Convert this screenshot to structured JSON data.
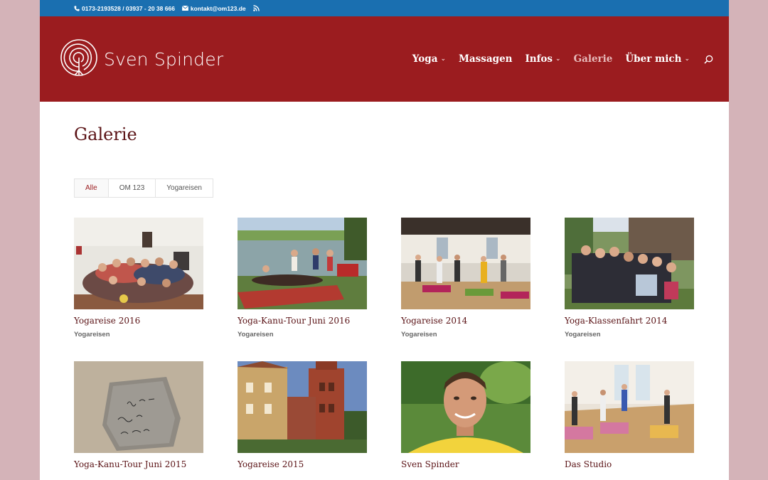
{
  "topbar": {
    "phone": "0173-2193528 / 03937 - 20 38 666",
    "email": "kontakt@om123.de"
  },
  "brand": {
    "name": "Sven Spinder"
  },
  "nav": [
    {
      "label": "Yoga",
      "dropdown": true,
      "active": false
    },
    {
      "label": "Massagen",
      "dropdown": false,
      "active": false
    },
    {
      "label": "Infos",
      "dropdown": true,
      "active": false
    },
    {
      "label": "Galerie",
      "dropdown": false,
      "active": true
    },
    {
      "label": "Über mich",
      "dropdown": true,
      "active": false
    }
  ],
  "page": {
    "title": "Galerie"
  },
  "filters": [
    "Alle",
    "OM 123",
    "Yogareisen"
  ],
  "gallery": [
    {
      "title": "Yogareise 2016",
      "category": "Yogareisen"
    },
    {
      "title": "Yoga-Kanu-Tour Juni 2016",
      "category": "Yogareisen"
    },
    {
      "title": "Yogareise 2014",
      "category": "Yogareisen"
    },
    {
      "title": "Yoga-Klassenfahrt 2014",
      "category": "Yogareisen"
    },
    {
      "title": "Yoga-Kanu-Tour Juni 2015",
      "category": ""
    },
    {
      "title": "Yogareise 2015",
      "category": ""
    },
    {
      "title": "Sven Spinder",
      "category": ""
    },
    {
      "title": "Das Studio",
      "category": ""
    }
  ],
  "colors": {
    "topbar": "#1a6fb0",
    "header": "#9b1c1f",
    "title": "#5a1215",
    "background": "#d4b3b8"
  }
}
